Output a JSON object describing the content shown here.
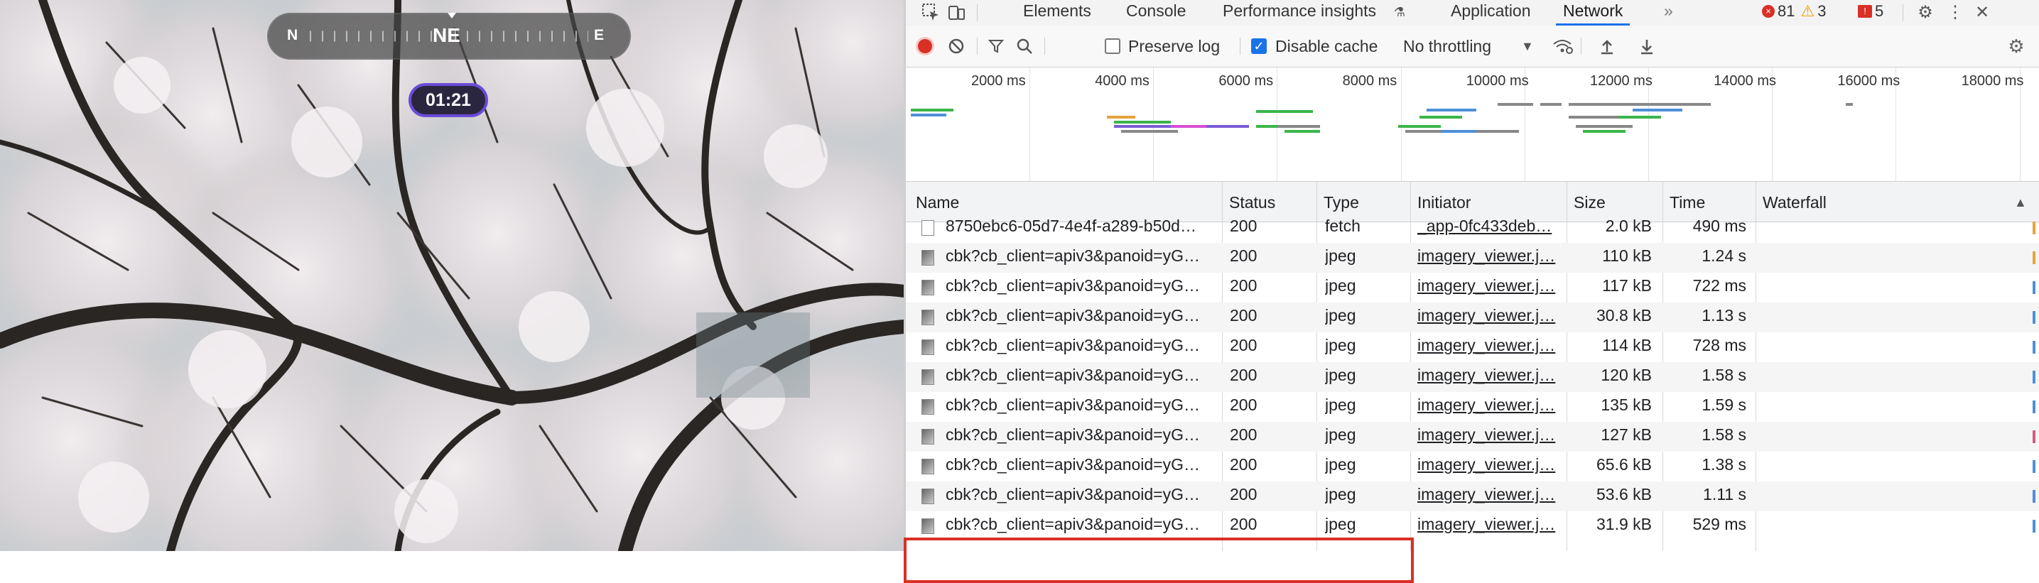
{
  "streetview": {
    "compass": {
      "left": "N",
      "main": "NE",
      "right": "E"
    },
    "timer": "01:21"
  },
  "devtools": {
    "tabs": [
      {
        "label": "Elements"
      },
      {
        "label": "Console"
      },
      {
        "label": "Performance insights"
      },
      {
        "label": "Application"
      },
      {
        "label": "Network"
      }
    ],
    "more_tabs": "»",
    "badges": {
      "errors": "81",
      "warnings": "3",
      "issues": "5"
    },
    "toolbar": {
      "preserve_log": "Preserve log",
      "disable_cache": "Disable cache",
      "throttling": "No throttling"
    },
    "overview": {
      "ticks": [
        "2000 ms",
        "4000 ms",
        "6000 ms",
        "8000 ms",
        "10000 ms",
        "12000 ms",
        "14000 ms",
        "16000 ms",
        "18000 ms"
      ]
    },
    "columns": [
      "Name",
      "Status",
      "Type",
      "Initiator",
      "Size",
      "Time",
      "Waterfall"
    ],
    "rows": [
      {
        "name": "8750ebc6-05d7-4e4f-a289-b50d…",
        "status": "200",
        "type": "fetch",
        "initiator": "_app-0fc433deb…",
        "size": "2.0 kB",
        "time": "490 ms",
        "wf": "#e8a33d"
      },
      {
        "name": "cbk?cb_client=apiv3&panoid=yG…",
        "status": "200",
        "type": "jpeg",
        "initiator": "imagery_viewer.j…",
        "size": "110 kB",
        "time": "1.24 s",
        "wf": "#e8a33d"
      },
      {
        "name": "cbk?cb_client=apiv3&panoid=yG…",
        "status": "200",
        "type": "jpeg",
        "initiator": "imagery_viewer.j…",
        "size": "117 kB",
        "time": "722 ms",
        "wf": "#4d90d8"
      },
      {
        "name": "cbk?cb_client=apiv3&panoid=yG…",
        "status": "200",
        "type": "jpeg",
        "initiator": "imagery_viewer.j…",
        "size": "30.8 kB",
        "time": "1.13 s",
        "wf": "#4d90d8"
      },
      {
        "name": "cbk?cb_client=apiv3&panoid=yG…",
        "status": "200",
        "type": "jpeg",
        "initiator": "imagery_viewer.j…",
        "size": "114 kB",
        "time": "728 ms",
        "wf": "#4d90d8"
      },
      {
        "name": "cbk?cb_client=apiv3&panoid=yG…",
        "status": "200",
        "type": "jpeg",
        "initiator": "imagery_viewer.j…",
        "size": "120 kB",
        "time": "1.58 s",
        "wf": "#4d90d8"
      },
      {
        "name": "cbk?cb_client=apiv3&panoid=yG…",
        "status": "200",
        "type": "jpeg",
        "initiator": "imagery_viewer.j…",
        "size": "135 kB",
        "time": "1.59 s",
        "wf": "#4d90d8"
      },
      {
        "name": "cbk?cb_client=apiv3&panoid=yG…",
        "status": "200",
        "type": "jpeg",
        "initiator": "imagery_viewer.j…",
        "size": "127 kB",
        "time": "1.58 s",
        "wf": "#d85a7f"
      },
      {
        "name": "cbk?cb_client=apiv3&panoid=yG…",
        "status": "200",
        "type": "jpeg",
        "initiator": "imagery_viewer.j…",
        "size": "65.6 kB",
        "time": "1.38 s",
        "wf": "#4d90d8"
      },
      {
        "name": "cbk?cb_client=apiv3&panoid=yG…",
        "status": "200",
        "type": "jpeg",
        "initiator": "imagery_viewer.j…",
        "size": "53.6 kB",
        "time": "1.11 s",
        "wf": "#4d90d8"
      },
      {
        "name": "cbk?cb_client=apiv3&panoid=yG…",
        "status": "200",
        "type": "jpeg",
        "initiator": "imagery_viewer.j…",
        "size": "31.9 kB",
        "time": "529 ms",
        "wf": "#4d90d8"
      }
    ]
  }
}
